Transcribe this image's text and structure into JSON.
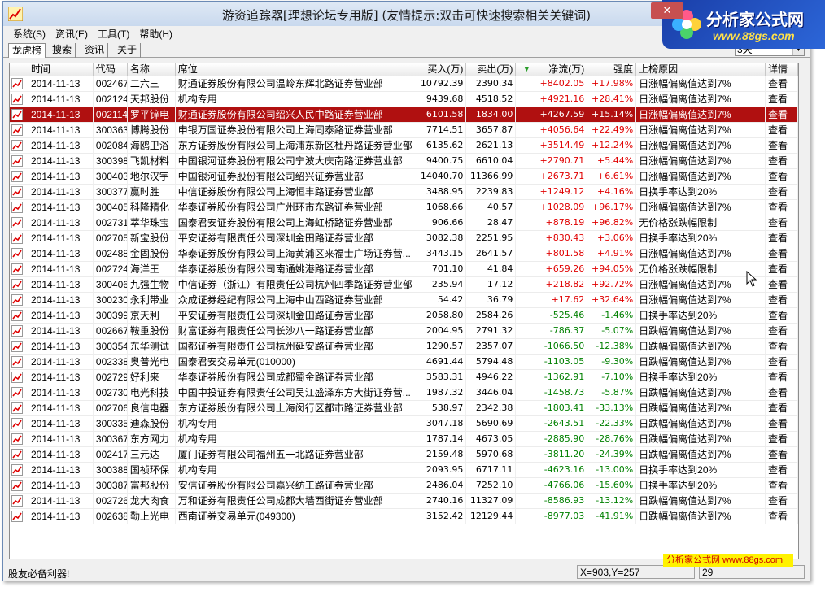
{
  "window": {
    "title": "游资追踪器[理想论坛专用版] (友情提示:双击可快速搜索相关关键词)",
    "close_label": "✕"
  },
  "brand": {
    "name": "分析家公式网",
    "url": "www.88gs.com"
  },
  "menu": [
    {
      "label": "系统(S)"
    },
    {
      "label": "资讯(E)"
    },
    {
      "label": "工具(T)"
    },
    {
      "label": "帮助(H)"
    }
  ],
  "tabs": [
    {
      "label": "龙虎榜",
      "active": true
    },
    {
      "label": "搜索",
      "active": false
    },
    {
      "label": "资讯",
      "active": false
    },
    {
      "label": "关于",
      "active": false
    }
  ],
  "range_select": {
    "value": "3天"
  },
  "columns": [
    "时间",
    "代码",
    "名称",
    "席位",
    "买入(万)",
    "卖出(万)",
    "净流(万)",
    "强度",
    "上榜原因",
    "详情"
  ],
  "sort_indicator": "▼",
  "rows": [
    {
      "date": "2014-11-13",
      "code": "002467",
      "name": "二六三",
      "seat": "财通证券股份有限公司温岭东辉北路证券营业部",
      "buy": "10792.39",
      "sell": "2390.34",
      "net": "+8402.05",
      "strength": "+17.98%",
      "reason": "日涨幅偏离值达到7%",
      "detail": "查看"
    },
    {
      "date": "2014-11-13",
      "code": "002124",
      "name": "天邦股份",
      "seat": "机构专用",
      "buy": "9439.68",
      "sell": "4518.52",
      "net": "+4921.16",
      "strength": "+28.41%",
      "reason": "日涨幅偏离值达到7%",
      "detail": "查看"
    },
    {
      "date": "2014-11-13",
      "code": "002114",
      "name": "罗平锌电",
      "seat": "财通证券股份有限公司绍兴人民中路证券营业部",
      "buy": "6101.58",
      "sell": "1834.00",
      "net": "+4267.59",
      "strength": "+15.14%",
      "reason": "日涨幅偏离值达到7%",
      "detail": "查看",
      "selected": true
    },
    {
      "date": "2014-11-13",
      "code": "300363",
      "name": "博腾股份",
      "seat": "申银万国证券股份有限公司上海同泰路证券营业部",
      "buy": "7714.51",
      "sell": "3657.87",
      "net": "+4056.64",
      "strength": "+22.49%",
      "reason": "日涨幅偏离值达到7%",
      "detail": "查看"
    },
    {
      "date": "2014-11-13",
      "code": "002084",
      "name": "海鸥卫浴",
      "seat": "东方证券股份有限公司上海浦东新区杜丹路证券营业部",
      "buy": "6135.62",
      "sell": "2621.13",
      "net": "+3514.49",
      "strength": "+12.24%",
      "reason": "日涨幅偏离值达到7%",
      "detail": "查看"
    },
    {
      "date": "2014-11-13",
      "code": "300398",
      "name": "飞凯材料",
      "seat": "中国银河证券股份有限公司宁波大庆南路证券营业部",
      "buy": "9400.75",
      "sell": "6610.04",
      "net": "+2790.71",
      "strength": "+5.44%",
      "reason": "日涨幅偏离值达到7%",
      "detail": "查看"
    },
    {
      "date": "2014-11-13",
      "code": "300403",
      "name": "地尔汉宇",
      "seat": "中国银河证券股份有限公司绍兴证券营业部",
      "buy": "14040.70",
      "sell": "11366.99",
      "net": "+2673.71",
      "strength": "+6.61%",
      "reason": "日涨幅偏离值达到7%",
      "detail": "查看"
    },
    {
      "date": "2014-11-13",
      "code": "300377",
      "name": "赢时胜",
      "seat": "中信证券股份有限公司上海恒丰路证券营业部",
      "buy": "3488.95",
      "sell": "2239.83",
      "net": "+1249.12",
      "strength": "+4.16%",
      "reason": "日换手率达到20%",
      "detail": "查看"
    },
    {
      "date": "2014-11-13",
      "code": "300405",
      "name": "科隆精化",
      "seat": "华泰证券股份有限公司广州环市东路证券营业部",
      "buy": "1068.66",
      "sell": "40.57",
      "net": "+1028.09",
      "strength": "+96.17%",
      "reason": "日涨幅偏离值达到7%",
      "detail": "查看"
    },
    {
      "date": "2014-11-13",
      "code": "002731",
      "name": "萃华珠宝",
      "seat": "国泰君安证券股份有限公司上海虹桥路证券营业部",
      "buy": "906.66",
      "sell": "28.47",
      "net": "+878.19",
      "strength": "+96.82%",
      "reason": "无价格涨跌幅限制",
      "detail": "查看"
    },
    {
      "date": "2014-11-13",
      "code": "002705",
      "name": "新宝股份",
      "seat": "平安证券有限责任公司深圳金田路证券营业部",
      "buy": "3082.38",
      "sell": "2251.95",
      "net": "+830.43",
      "strength": "+3.06%",
      "reason": "日换手率达到20%",
      "detail": "查看"
    },
    {
      "date": "2014-11-13",
      "code": "002488",
      "name": "金固股份",
      "seat": "华泰证券股份有限公司上海黄浦区来福士广场证券营...",
      "buy": "3443.15",
      "sell": "2641.57",
      "net": "+801.58",
      "strength": "+4.91%",
      "reason": "日涨幅偏离值达到7%",
      "detail": "查看"
    },
    {
      "date": "2014-11-13",
      "code": "002724",
      "name": "海洋王",
      "seat": "华泰证券股份有限公司南通姚港路证券营业部",
      "buy": "701.10",
      "sell": "41.84",
      "net": "+659.26",
      "strength": "+94.05%",
      "reason": "无价格涨跌幅限制",
      "detail": "查看"
    },
    {
      "date": "2014-11-13",
      "code": "300406",
      "name": "九强生物",
      "seat": "中信证券（浙江）有限责任公司杭州四季路证券营业部",
      "buy": "235.94",
      "sell": "17.12",
      "net": "+218.82",
      "strength": "+92.72%",
      "reason": "日涨幅偏离值达到7%",
      "detail": "查看"
    },
    {
      "date": "2014-11-13",
      "code": "300230",
      "name": "永利带业",
      "seat": "众成证券经纪有限公司上海中山西路证券营业部",
      "buy": "54.42",
      "sell": "36.79",
      "net": "+17.62",
      "strength": "+32.64%",
      "reason": "日涨幅偏离值达到7%",
      "detail": "查看"
    },
    {
      "date": "2014-11-13",
      "code": "300399",
      "name": "京天利",
      "seat": "平安证券有限责任公司深圳金田路证券营业部",
      "buy": "2058.80",
      "sell": "2584.26",
      "net": "-525.46",
      "strength": "-1.46%",
      "reason": "日换手率达到20%",
      "detail": "查看"
    },
    {
      "date": "2014-11-13",
      "code": "002667",
      "name": "鞍重股份",
      "seat": "财富证券有限责任公司长沙八一路证券营业部",
      "buy": "2004.95",
      "sell": "2791.32",
      "net": "-786.37",
      "strength": "-5.07%",
      "reason": "日跌幅偏离值达到7%",
      "detail": "查看"
    },
    {
      "date": "2014-11-13",
      "code": "300354",
      "name": "东华测试",
      "seat": "国都证券有限责任公司杭州延安路证券营业部",
      "buy": "1290.57",
      "sell": "2357.07",
      "net": "-1066.50",
      "strength": "-12.38%",
      "reason": "日跌幅偏离值达到7%",
      "detail": "查看"
    },
    {
      "date": "2014-11-13",
      "code": "002338",
      "name": "奥普光电",
      "seat": "国泰君安交易单元(010000)",
      "buy": "4691.44",
      "sell": "5794.48",
      "net": "-1103.05",
      "strength": "-9.30%",
      "reason": "日跌幅偏离值达到7%",
      "detail": "查看"
    },
    {
      "date": "2014-11-13",
      "code": "002729",
      "name": "好利来",
      "seat": "华泰证券股份有限公司成都蜀金路证券营业部",
      "buy": "3583.31",
      "sell": "4946.22",
      "net": "-1362.91",
      "strength": "-7.10%",
      "reason": "日换手率达到20%",
      "detail": "查看"
    },
    {
      "date": "2014-11-13",
      "code": "002730",
      "name": "电光科技",
      "seat": "中国中投证券有限责任公司吴江盛泽东方大街证券营...",
      "buy": "1987.32",
      "sell": "3446.04",
      "net": "-1458.73",
      "strength": "-5.87%",
      "reason": "日跌幅偏离值达到7%",
      "detail": "查看"
    },
    {
      "date": "2014-11-13",
      "code": "002706",
      "name": "良信电器",
      "seat": "东方证券股份有限公司上海闵行区都市路证券营业部",
      "buy": "538.97",
      "sell": "2342.38",
      "net": "-1803.41",
      "strength": "-33.13%",
      "reason": "日跌幅偏离值达到7%",
      "detail": "查看"
    },
    {
      "date": "2014-11-13",
      "code": "300335",
      "name": "迪森股份",
      "seat": "机构专用",
      "buy": "3047.18",
      "sell": "5690.69",
      "net": "-2643.51",
      "strength": "-22.33%",
      "reason": "日跌幅偏离值达到7%",
      "detail": "查看"
    },
    {
      "date": "2014-11-13",
      "code": "300367",
      "name": "东方网力",
      "seat": "机构专用",
      "buy": "1787.14",
      "sell": "4673.05",
      "net": "-2885.90",
      "strength": "-28.76%",
      "reason": "日跌幅偏离值达到7%",
      "detail": "查看"
    },
    {
      "date": "2014-11-13",
      "code": "002417",
      "name": "三元达",
      "seat": "厦门证券有限公司福州五一北路证券营业部",
      "buy": "2159.48",
      "sell": "5970.68",
      "net": "-3811.20",
      "strength": "-24.39%",
      "reason": "日跌幅偏离值达到7%",
      "detail": "查看"
    },
    {
      "date": "2014-11-13",
      "code": "300388",
      "name": "国祯环保",
      "seat": "机构专用",
      "buy": "2093.95",
      "sell": "6717.11",
      "net": "-4623.16",
      "strength": "-13.00%",
      "reason": "日换手率达到20%",
      "detail": "查看"
    },
    {
      "date": "2014-11-13",
      "code": "300387",
      "name": "富邦股份",
      "seat": "安信证券股份有限公司嘉兴纺工路证券营业部",
      "buy": "2486.04",
      "sell": "7252.10",
      "net": "-4766.06",
      "strength": "-15.60%",
      "reason": "日换手率达到20%",
      "detail": "查看"
    },
    {
      "date": "2014-11-13",
      "code": "002726",
      "name": "龙大肉食",
      "seat": "万和证券有限责任公司成都大墙西街证券营业部",
      "buy": "2740.16",
      "sell": "11327.09",
      "net": "-8586.93",
      "strength": "-13.12%",
      "reason": "日跌幅偏离值达到7%",
      "detail": "查看"
    },
    {
      "date": "2014-11-13",
      "code": "002638",
      "name": "勤上光电",
      "seat": "西南证券交易单元(049300)",
      "buy": "3152.42",
      "sell": "12129.44",
      "net": "-8977.03",
      "strength": "-41.91%",
      "reason": "日跌幅偏离值达到7%",
      "detail": "查看"
    }
  ],
  "status": {
    "message": "股友必备利器!",
    "coords": "X=903,Y=257",
    "count": "29"
  },
  "watermark": "分析家公式网 www.88gs.com",
  "colors": {
    "up": "#e00000",
    "down": "#008000",
    "selected_row": "#b01010"
  }
}
